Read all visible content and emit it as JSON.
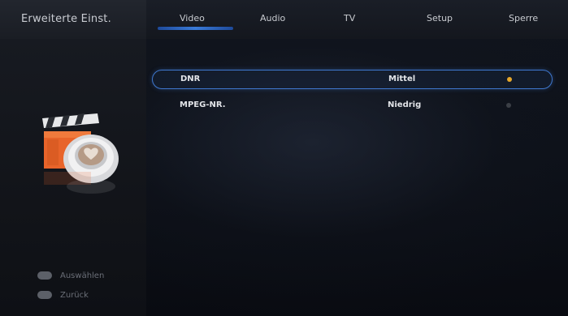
{
  "header": {
    "section_title": "Erweiterte Einst.",
    "tabs": [
      {
        "label": "Video",
        "active": true
      },
      {
        "label": "Audio",
        "active": false
      },
      {
        "label": "TV",
        "active": false
      },
      {
        "label": "Setup",
        "active": false
      },
      {
        "label": "Sperre",
        "active": false
      }
    ]
  },
  "settings": [
    {
      "label": "DNR",
      "value": "Mittel",
      "selected": true
    },
    {
      "label": "MPEG-NR.",
      "value": "Niedrig",
      "selected": false
    }
  ],
  "legend": [
    {
      "key_icon": "ok-button-icon",
      "label": "Auswählen"
    },
    {
      "key_icon": "menu-button-icon",
      "label": "Zurück"
    }
  ],
  "colors": {
    "accent_blue": "#3f78cf",
    "indicator_active": "#e6a72b",
    "clapper_orange": "#e8642a"
  }
}
